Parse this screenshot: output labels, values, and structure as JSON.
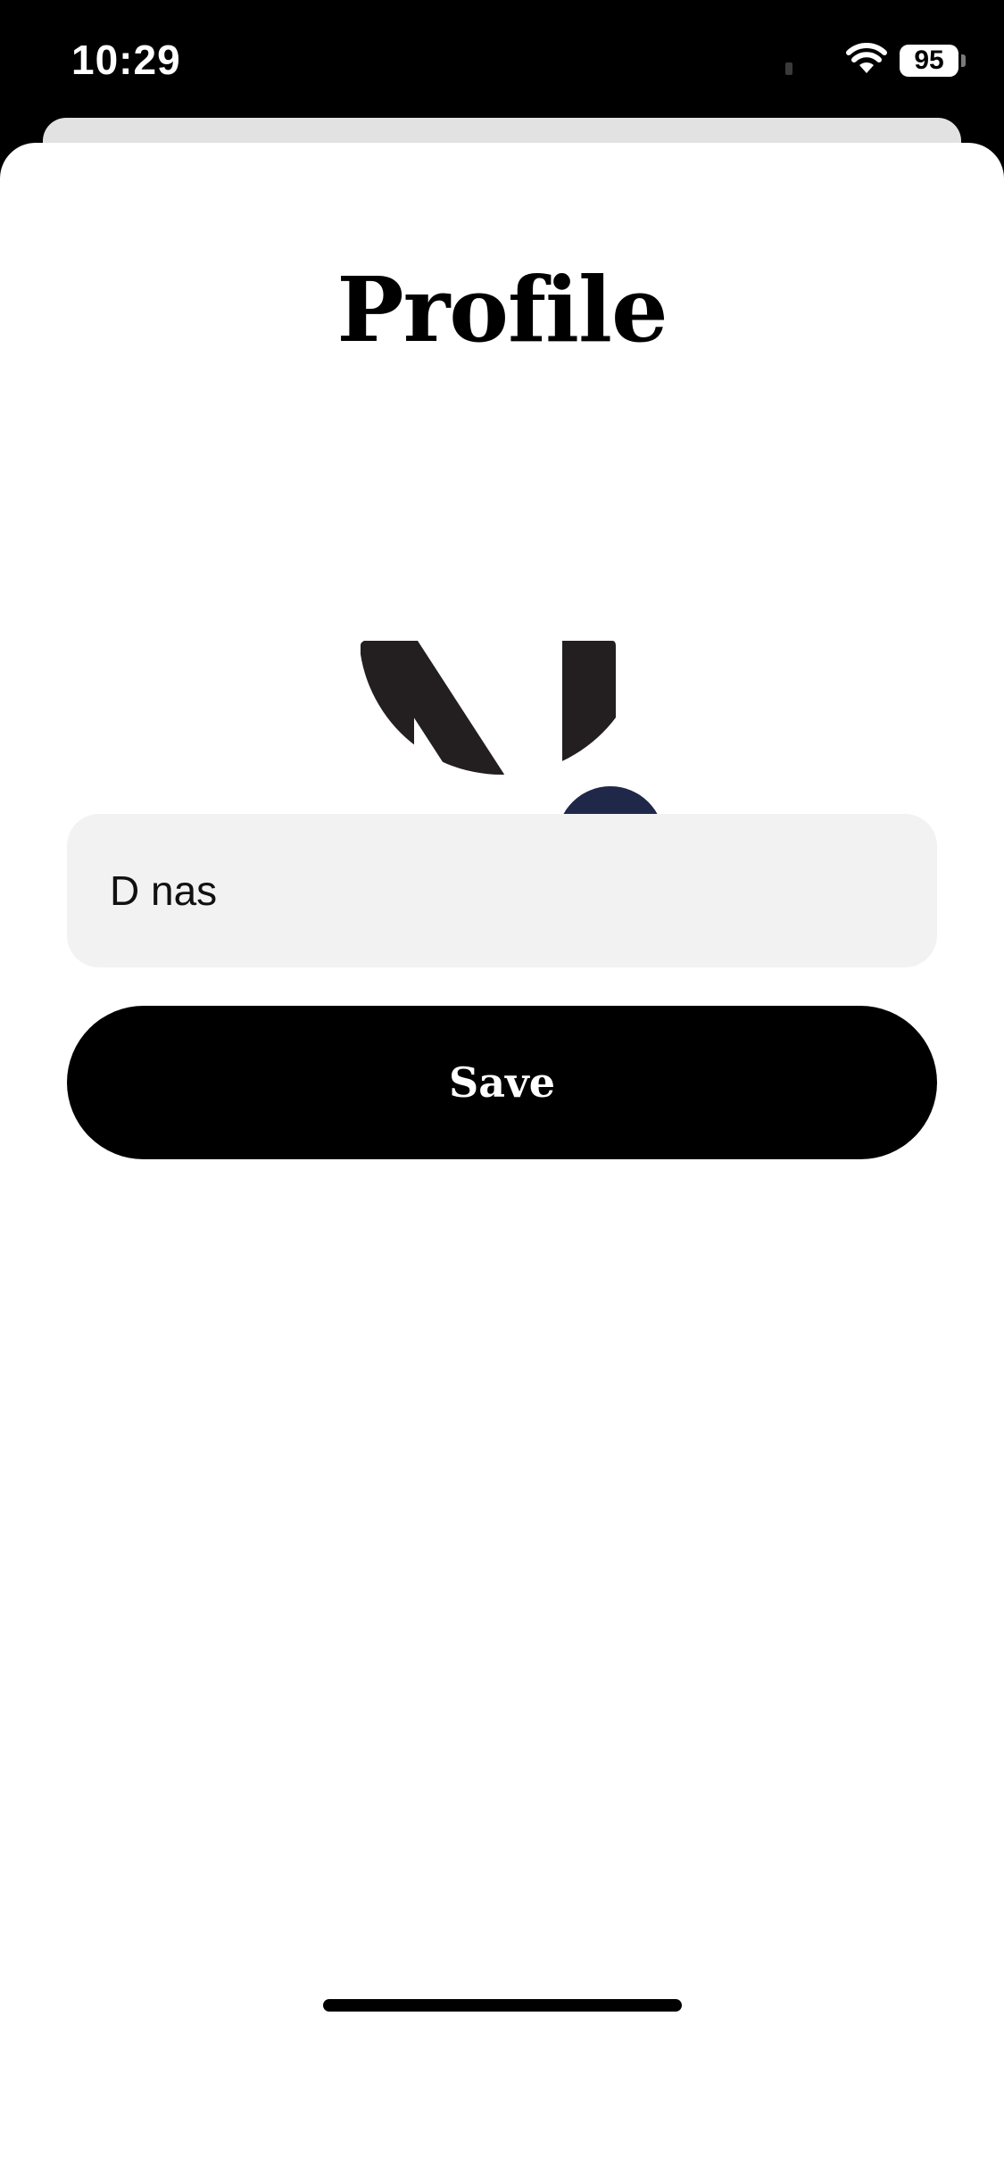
{
  "status_bar": {
    "time": "10:29",
    "battery": "95",
    "icons": [
      "signal-icon",
      "wifi-icon",
      "battery-icon"
    ]
  },
  "profile": {
    "title": "Profile",
    "avatar_letter": "N",
    "camera_icon": "camera-icon",
    "name_value": "D nas",
    "save_label": "Save"
  },
  "colors": {
    "background": "#ffffff",
    "status_bar": "#000000",
    "input_background": "#f2f2f2",
    "save_button": "#000000",
    "camera_button": "#20284a"
  }
}
